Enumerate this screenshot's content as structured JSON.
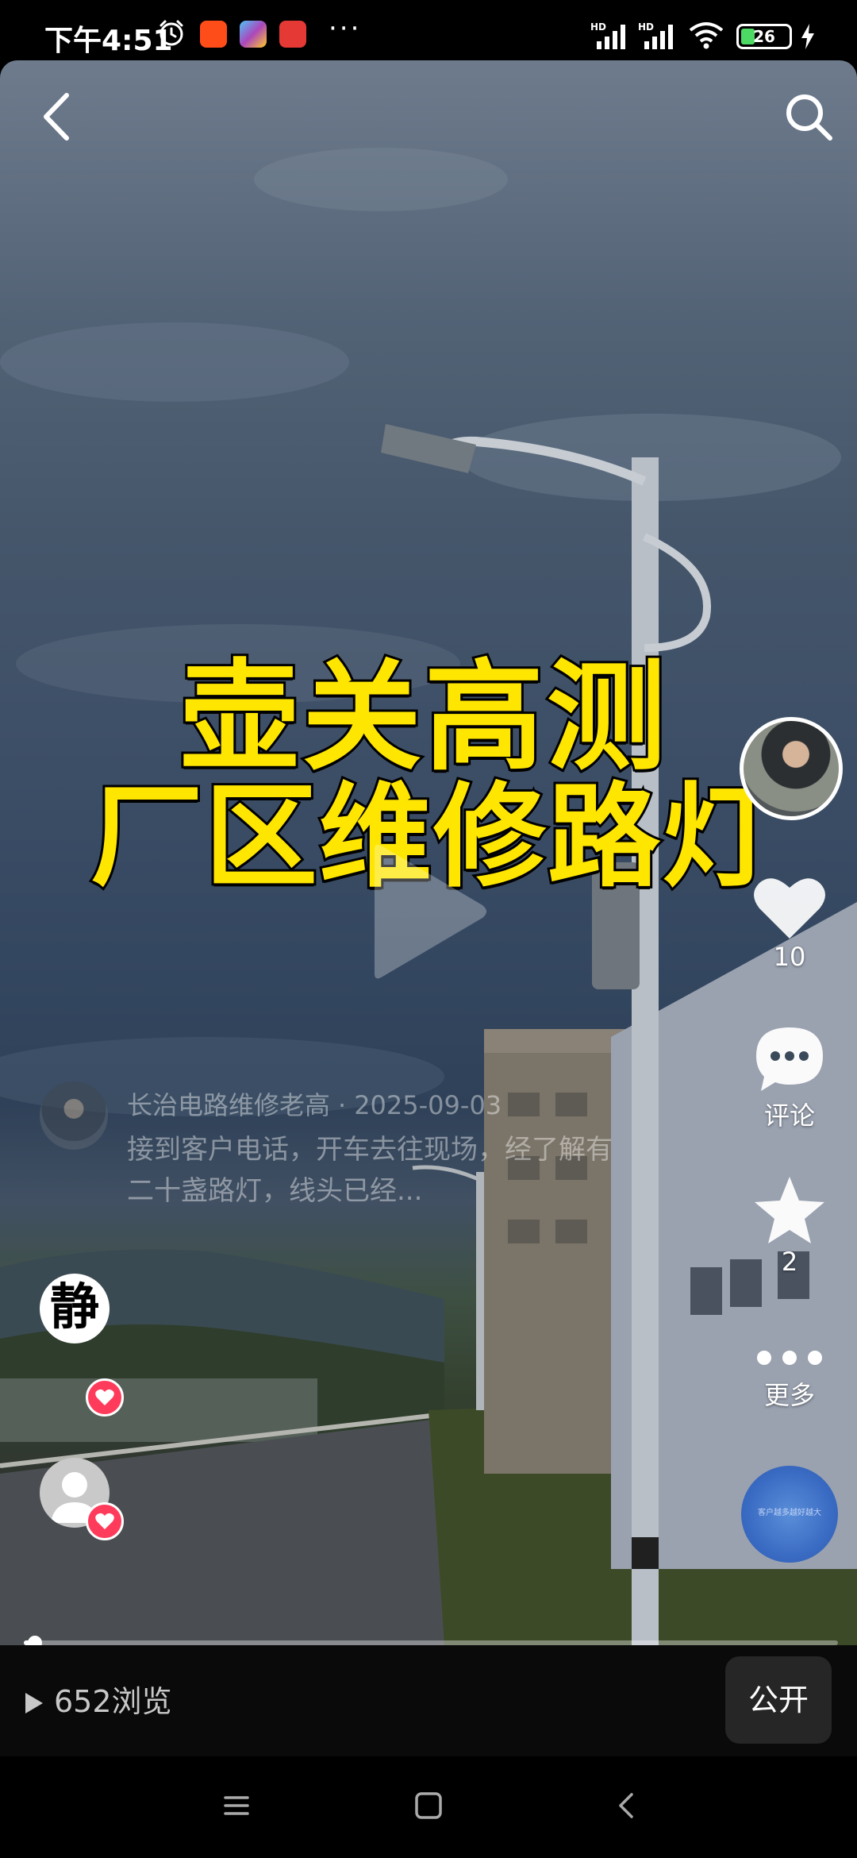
{
  "status_bar": {
    "time": "下午4:51",
    "icons": [
      "alarm-icon",
      "taobao-app-icon",
      "gallery-app-icon",
      "kan-app-icon",
      "more-dots"
    ],
    "more": "···",
    "signal_label_1": "HD",
    "signal_label_2": "HD",
    "battery": "26",
    "battery_level": 0.26,
    "charging": true
  },
  "video": {
    "title_line1": "壶关高测",
    "title_line2": "厂区维修路灯",
    "colors": {
      "title": "#ffe600",
      "title_stroke": "#000000"
    }
  },
  "actions": {
    "like_count": "10",
    "comment_label": "评论",
    "favorite_count": "2",
    "more_label": "更多"
  },
  "caption": {
    "author": "长治电路维修老高",
    "date": "2025-09-03",
    "text": "接到客户电话，开车去往现场，经了解有二十盏路灯，线头已经..."
  },
  "liker_1_char": "静",
  "music_disc_text": "客户越多越好越大",
  "progress": {
    "fraction": 0.014
  },
  "bottom_bar": {
    "views": "652浏览",
    "public_label": "公开"
  },
  "colors": {
    "accent_heart": "#ff3b5c",
    "battery_fill": "#4cd964"
  }
}
